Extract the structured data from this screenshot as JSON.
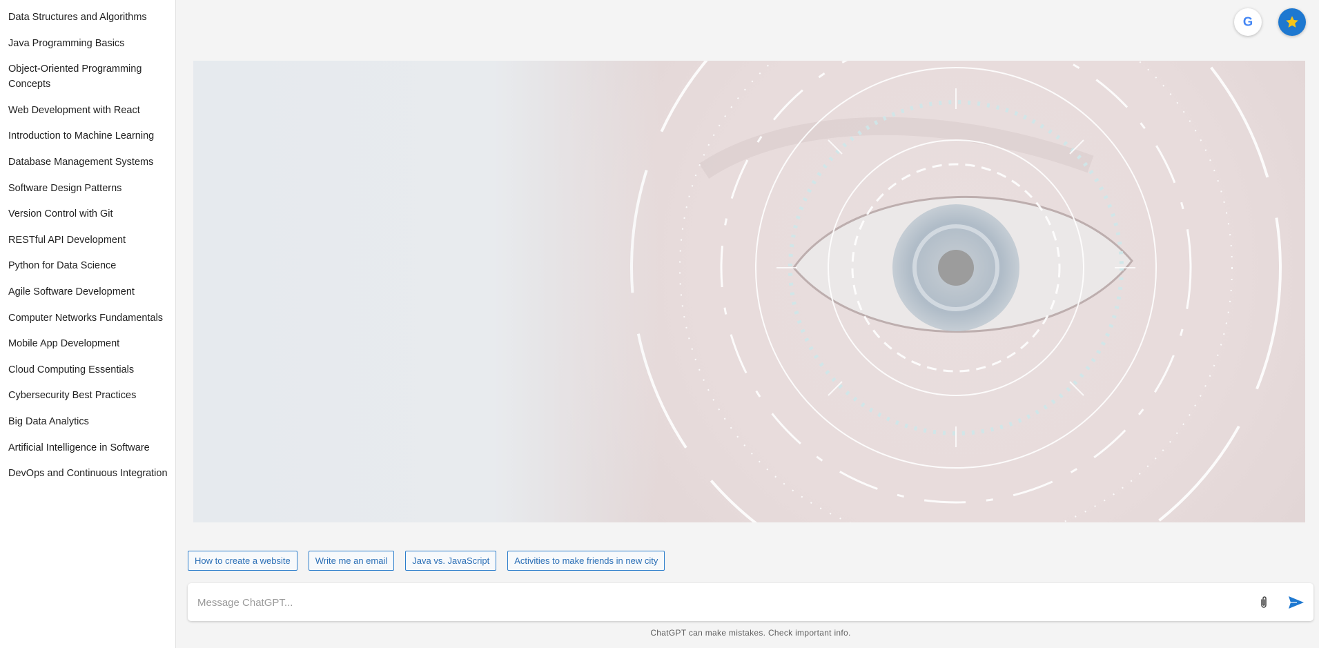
{
  "sidebar": {
    "items": [
      {
        "label": "Data Structures and Algorithms"
      },
      {
        "label": "Java Programming Basics"
      },
      {
        "label": "Object-Oriented Programming Concepts"
      },
      {
        "label": "Web Development with React"
      },
      {
        "label": "Introduction to Machine Learning"
      },
      {
        "label": "Database Management Systems"
      },
      {
        "label": "Software Design Patterns"
      },
      {
        "label": "Version Control with Git"
      },
      {
        "label": "RESTful API Development"
      },
      {
        "label": "Python for Data Science"
      },
      {
        "label": "Agile Software Development"
      },
      {
        "label": "Computer Networks Fundamentals"
      },
      {
        "label": "Mobile App Development"
      },
      {
        "label": "Cloud Computing Essentials"
      },
      {
        "label": "Cybersecurity Best Practices"
      },
      {
        "label": "Big Data Analytics"
      },
      {
        "label": "Artificial Intelligence in Software"
      },
      {
        "label": "DevOps and Continuous Integration"
      }
    ]
  },
  "header": {
    "icons": [
      {
        "name": "google-icon",
        "color": "#4285f4"
      },
      {
        "name": "star-icon",
        "color": "#f5c518",
        "background": "#1e78d0"
      }
    ]
  },
  "hero": {
    "image": "eye-iris-hud-illustration"
  },
  "suggestions": [
    {
      "label": "How to create a website"
    },
    {
      "label": "Write me an email"
    },
    {
      "label": "Java vs. JavaScript"
    },
    {
      "label": "Activities to make friends in new city"
    }
  ],
  "composer": {
    "placeholder": "Message ChatGPT...",
    "value": "",
    "icons": [
      "paperclip-icon",
      "send-icon"
    ]
  },
  "footer": {
    "disclaimer": "ChatGPT can make mistakes. Check important info."
  },
  "colors": {
    "accent": "#1e78d0",
    "chip_border": "#2b7dcb",
    "background": "#f4f4f4",
    "sidebar_bg": "#ffffff"
  }
}
